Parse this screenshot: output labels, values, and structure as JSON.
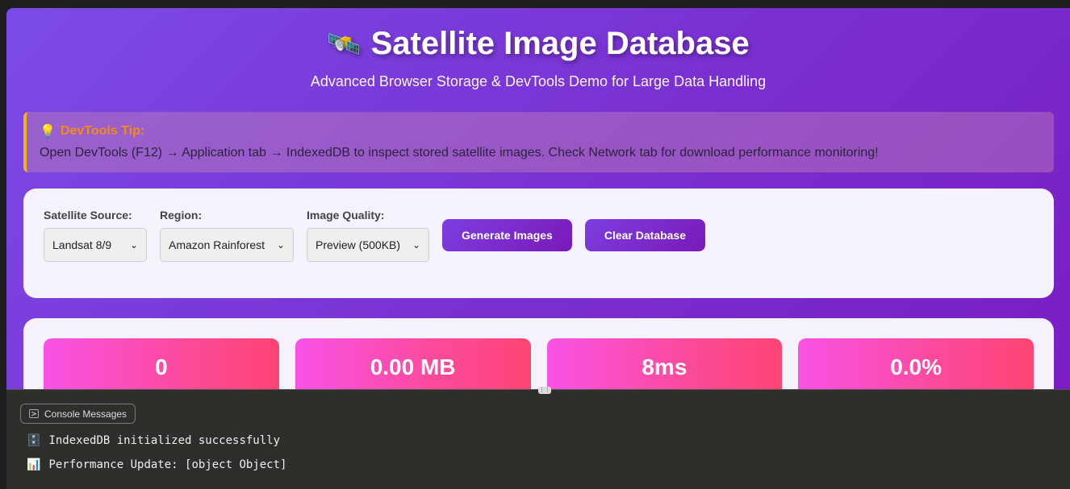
{
  "header": {
    "icon": "satellite-icon",
    "icon_glyph": "🛰️",
    "title": "Satellite Image Database",
    "subtitle": "Advanced Browser Storage & DevTools Demo for Large Data Handling"
  },
  "tip": {
    "icon_glyph": "💡",
    "title": "DevTools Tip:",
    "text": "Open DevTools (F12) → Application tab → IndexedDB to inspect stored satellite images. Check Network tab for download performance monitoring!"
  },
  "controls": {
    "source_label": "Satellite Source:",
    "source_value": "Landsat 8/9",
    "region_label": "Region:",
    "region_value": "Amazon Rainforest",
    "quality_label": "Image Quality:",
    "quality_value": "Preview (500KB)",
    "generate_label": "Generate Images",
    "clear_label": "Clear Database"
  },
  "stats": [
    "0",
    "0.00 MB",
    "8ms",
    "0.0%"
  ],
  "console": {
    "tab_label": "Console Messages",
    "lines": [
      {
        "icon": "🗄️",
        "text": "IndexedDB initialized successfully"
      },
      {
        "icon": "📊",
        "text": "Performance Update: [object Object]"
      }
    ]
  },
  "colors": {
    "accent": "#7a2fd0",
    "tip_border": "#f5b312",
    "tip_title": "#f58b14",
    "stat_gradient_start": "#f952e6",
    "stat_gradient_end": "#ff4474"
  }
}
